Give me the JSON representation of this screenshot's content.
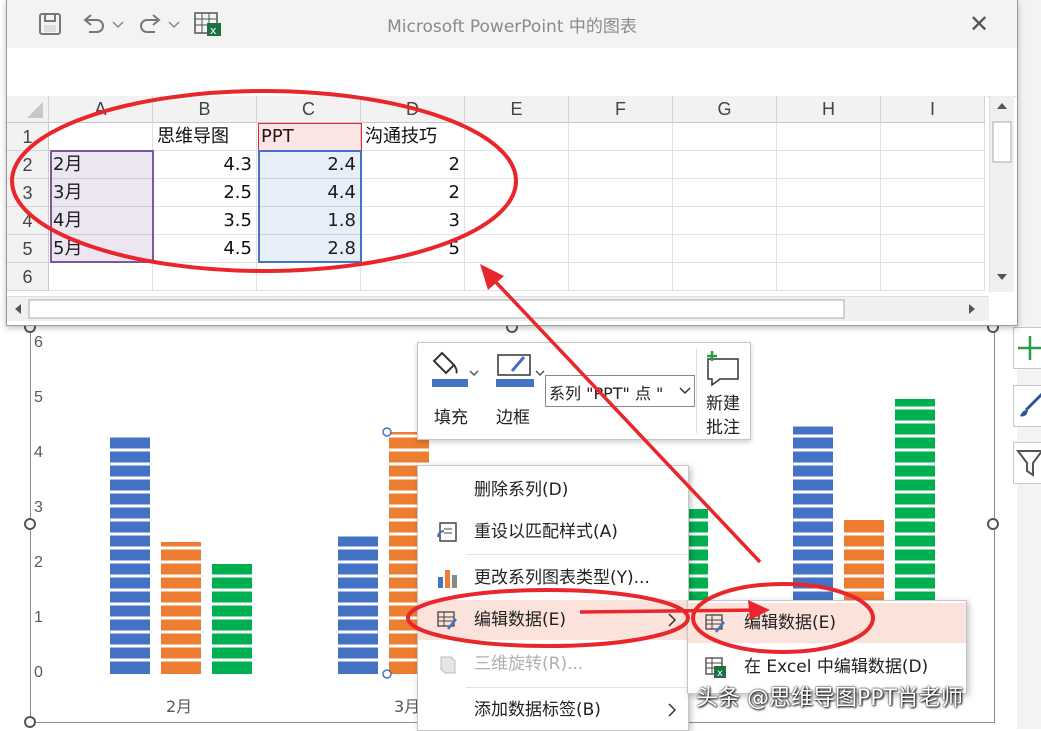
{
  "window": {
    "title": "Microsoft PowerPoint 中的图表",
    "close_glyph": "✕"
  },
  "sheet": {
    "columns": [
      "A",
      "B",
      "C",
      "D",
      "E",
      "F",
      "G",
      "H",
      "I"
    ],
    "rows": [
      "1",
      "2",
      "3",
      "4",
      "5",
      "6"
    ],
    "header_row": [
      "",
      "思维导图",
      "PPT",
      "沟通技巧"
    ],
    "data_rows": [
      [
        "2月",
        "4.3",
        "2.4",
        "2"
      ],
      [
        "3月",
        "2.5",
        "4.4",
        "2"
      ],
      [
        "4月",
        "3.5",
        "1.8",
        "3"
      ],
      [
        "5月",
        "4.5",
        "2.8",
        "5"
      ]
    ]
  },
  "chart_data": {
    "type": "bar",
    "categories": [
      "2月",
      "3月",
      "4月",
      "5月"
    ],
    "series": [
      {
        "name": "思维导图",
        "values": [
          4.3,
          2.5,
          3.5,
          4.5
        ],
        "color": "#4472C4"
      },
      {
        "name": "PPT",
        "values": [
          2.4,
          4.4,
          1.8,
          2.8
        ],
        "color": "#ED7D31"
      },
      {
        "name": "沟通技巧",
        "values": [
          2,
          2,
          3,
          5
        ],
        "color": "#00B050"
      }
    ],
    "ylim": [
      0,
      6
    ],
    "yticks": [
      "0",
      "1",
      "2",
      "3",
      "4",
      "5",
      "6"
    ],
    "visible_x_labels": [
      "2月",
      "3月"
    ],
    "grid": false
  },
  "mini_toolbar": {
    "fill_label": "填充",
    "border_label": "边框",
    "series_select": "系列 \"PPT\" 点 \"",
    "new_comment_label_1": "新建",
    "new_comment_label_2": "批注"
  },
  "context_menu": {
    "items": [
      {
        "label": "删除系列(D)",
        "enabled": true
      },
      {
        "label": "重设以匹配样式(A)",
        "enabled": true
      },
      {
        "label": "更改系列图表类型(Y)...",
        "enabled": true
      },
      {
        "label": "编辑数据(E)",
        "enabled": true,
        "submenu": true
      },
      {
        "label": "三维旋转(R)...",
        "enabled": false
      },
      {
        "label": "添加数据标签(B)",
        "enabled": true,
        "submenu": true
      }
    ]
  },
  "submenu": {
    "items": [
      {
        "label": "编辑数据(E)"
      },
      {
        "label": "在 Excel 中编辑数据(D)"
      }
    ]
  },
  "watermark": "头条 @思维导图PPT肖老师",
  "colors": {
    "annotation_red": "#E8262B",
    "selection_blue": "#4472C4",
    "selection_purple": "#7E57A3"
  }
}
